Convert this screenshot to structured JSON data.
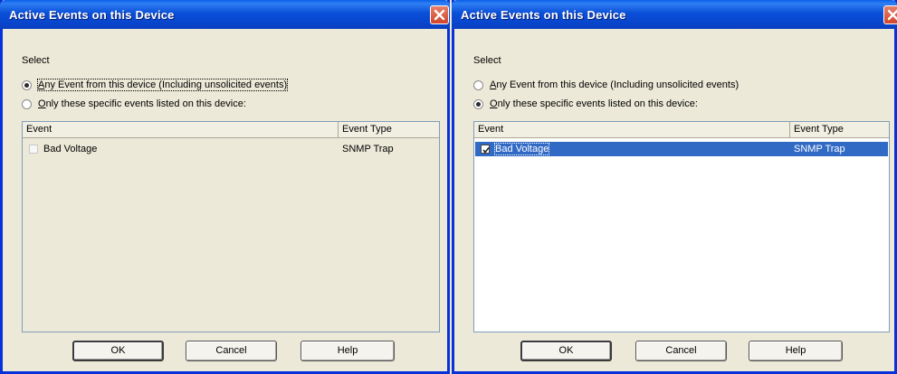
{
  "dialogs": [
    {
      "title": "Active Events on this Device",
      "select_label": "Select",
      "options": [
        {
          "label_accel": "A",
          "label_rest": "ny Event from this device (Including unsolicited events)",
          "checked": true
        },
        {
          "label_accel": "O",
          "label_rest": "nly these specific events listed on this device:",
          "checked": false
        }
      ],
      "columns": [
        "Event",
        "Event Type"
      ],
      "rows": [
        {
          "event": "Bad Voltage",
          "event_type": "SNMP Trap",
          "checked": false,
          "selected": false
        }
      ],
      "buttons": {
        "ok": "OK",
        "cancel": "Cancel",
        "help": "Help"
      }
    },
    {
      "title": "Active Events on this Device",
      "select_label": "Select",
      "options": [
        {
          "label_accel": "A",
          "label_rest": "ny Event from this device (Including unsolicited events)",
          "checked": false
        },
        {
          "label_accel": "O",
          "label_rest": "nly these specific events listed on this device:",
          "checked": true
        }
      ],
      "columns": [
        "Event",
        "Event Type"
      ],
      "rows": [
        {
          "event": "Bad Voltage",
          "event_type": "SNMP Trap",
          "checked": true,
          "selected": true
        }
      ],
      "buttons": {
        "ok": "OK",
        "cancel": "Cancel",
        "help": "Help"
      }
    }
  ],
  "icons": {
    "close": "close-x-icon",
    "check": "checkmark-icon"
  },
  "colors": {
    "title_bar": "#0a4fd8",
    "close_button": "#d0452a",
    "selection": "#316ac5",
    "dialog_bg": "#ece9d8"
  }
}
